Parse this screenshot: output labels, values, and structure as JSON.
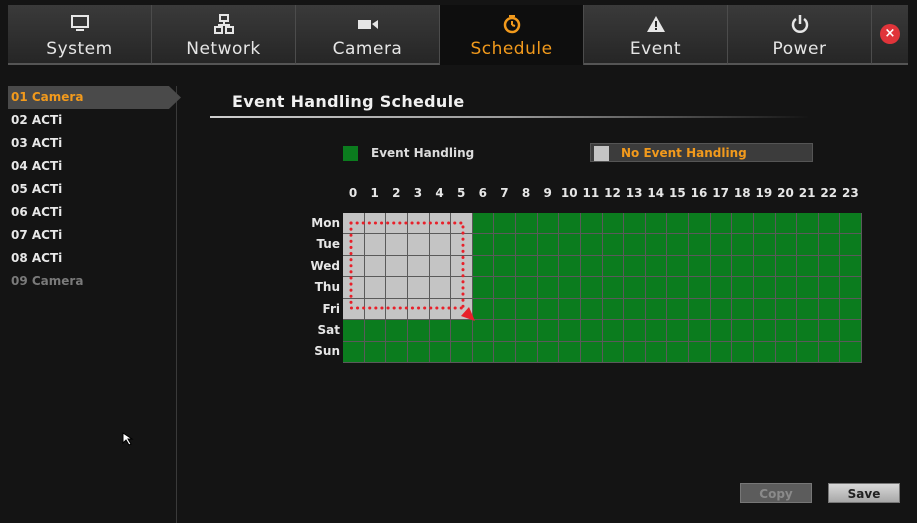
{
  "tabs": [
    {
      "label": "System",
      "icon": "monitor-icon",
      "active": false
    },
    {
      "label": "Network",
      "icon": "network-icon",
      "active": false
    },
    {
      "label": "Camera",
      "icon": "camera-icon",
      "active": false
    },
    {
      "label": "Schedule",
      "icon": "schedule-clock-icon",
      "active": true
    },
    {
      "label": "Event",
      "icon": "warning-icon",
      "active": false
    },
    {
      "label": "Power",
      "icon": "power-icon",
      "active": false
    }
  ],
  "close_icon": "close-icon",
  "sidebar": {
    "items": [
      {
        "label": "01 Camera",
        "state": "selected"
      },
      {
        "label": "02 ACTi",
        "state": "normal"
      },
      {
        "label": "03 ACTi",
        "state": "normal"
      },
      {
        "label": "04 ACTi",
        "state": "normal"
      },
      {
        "label": "05 ACTi",
        "state": "normal"
      },
      {
        "label": "06 ACTi",
        "state": "normal"
      },
      {
        "label": "07 ACTi",
        "state": "normal"
      },
      {
        "label": "08 ACTi",
        "state": "normal"
      },
      {
        "label": "09 Camera",
        "state": "disabled"
      }
    ]
  },
  "main": {
    "title": "Event Handling Schedule",
    "legend": {
      "event_handling": "Event Handling",
      "no_event_handling": "No Event Handling"
    },
    "hours": [
      "0",
      "1",
      "2",
      "3",
      "4",
      "5",
      "6",
      "7",
      "8",
      "9",
      "10",
      "11",
      "12",
      "13",
      "14",
      "15",
      "16",
      "17",
      "18",
      "19",
      "20",
      "21",
      "22",
      "23"
    ],
    "days": [
      "Mon",
      "Tue",
      "Wed",
      "Thu",
      "Fri",
      "Sat",
      "Sun"
    ],
    "schedule": {
      "no_event_handling_days": [
        "Mon",
        "Tue",
        "Wed",
        "Thu",
        "Fri"
      ],
      "no_event_handling_hours": [
        "0",
        "1",
        "2",
        "3",
        "4",
        "5"
      ]
    },
    "buttons": {
      "copy": "Copy",
      "save": "Save"
    }
  },
  "colors": {
    "accent": "#f29a1c",
    "event_handling": "#0b7c1e",
    "no_event_handling": "#c4c4c4",
    "drag_marker": "#e8202a"
  }
}
